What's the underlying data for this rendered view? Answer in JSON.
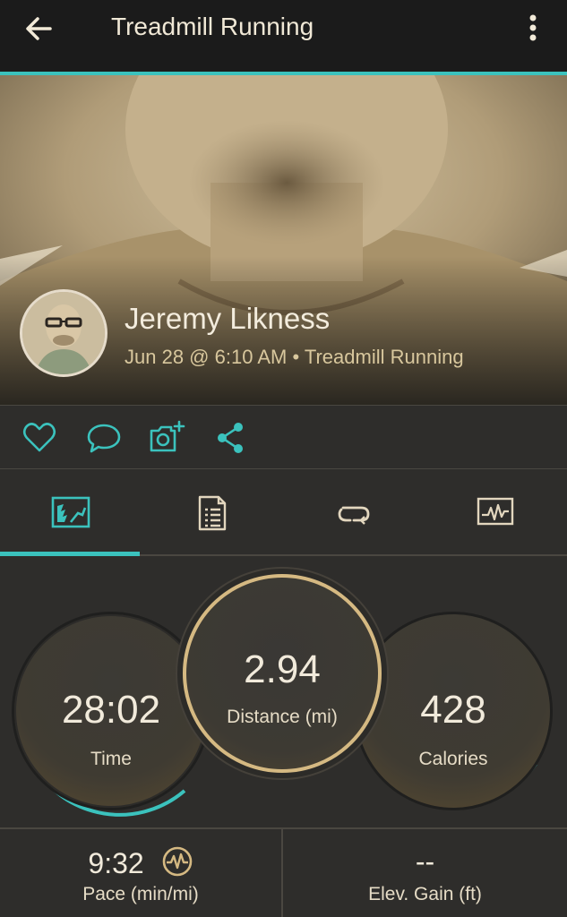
{
  "appbar": {
    "title": "Treadmill Running",
    "back_icon": "arrow-left-icon",
    "more_icon": "more-vertical-icon"
  },
  "hero": {
    "author": "Jeremy Likness",
    "meta": "Jun 28 @ 6:10 AM • Treadmill Running"
  },
  "social": {
    "icons": [
      "heart-icon",
      "comment-icon",
      "add-photo-icon",
      "share-icon"
    ]
  },
  "tabs": {
    "icons": [
      "stats-tab-icon",
      "details-tab-icon",
      "laps-tab-icon",
      "chart-tab-icon"
    ],
    "selected_index": 0
  },
  "stats": {
    "time": {
      "value": "28:02",
      "label": "Time"
    },
    "distance": {
      "value": "2.94",
      "label": "Distance (mi)"
    },
    "calories": {
      "value": "428",
      "label": "Calories"
    }
  },
  "metrics": {
    "pace": {
      "value": "9:32",
      "label": "Pace (min/mi)",
      "icon": "heart-rate-icon"
    },
    "elevation": {
      "value": "--",
      "label": "Elev. Gain (ft)"
    }
  },
  "colors": {
    "accent": "#3bc2bd",
    "gold": "#d5b982",
    "background": "#2e2d2b",
    "appbar": "#1b1b1b"
  }
}
